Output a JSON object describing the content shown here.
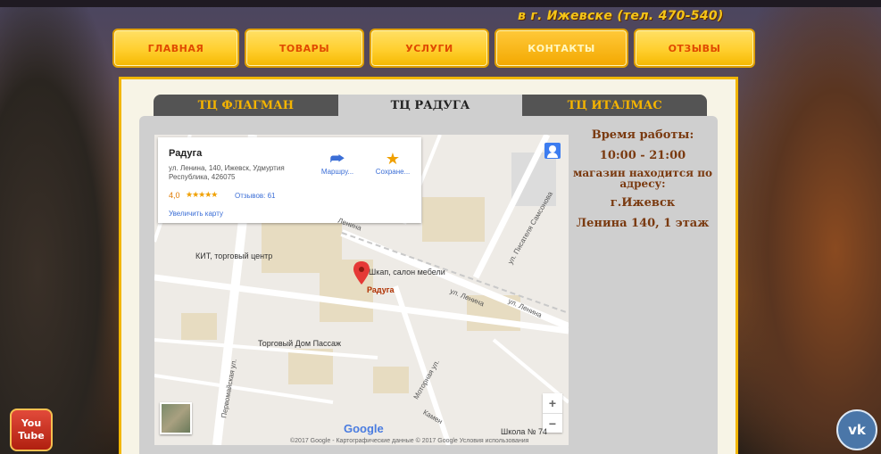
{
  "header": {
    "phone_line": "в г. Ижевске (тел. 470-540)"
  },
  "nav": {
    "items": [
      {
        "label": "ГЛАВНАЯ"
      },
      {
        "label": "ТОВАРЫ"
      },
      {
        "label": "УСЛУГИ"
      },
      {
        "label": "КОНТАКТЫ",
        "active": true
      },
      {
        "label": "ОТЗЫВЫ"
      }
    ]
  },
  "tabs": [
    {
      "label": "ТЦ ФЛАГМАН"
    },
    {
      "label": "ТЦ РАДУГА",
      "active": true
    },
    {
      "label": "ТЦ ИТАЛМАС"
    }
  ],
  "map": {
    "place_name": "Радуга",
    "address": "ул. Ленина, 140, Ижевск, Удмуртия Республика, 426075",
    "rating": "4,0",
    "stars": "★★★★★",
    "reviews": "Отзывов: 61",
    "enlarge": "Увеличить карту",
    "route_label": "Маршру...",
    "save_label": "Сохране...",
    "labels": {
      "kit": "КИТ, торговый центр",
      "shkap": "Шкап, салон мебели",
      "raduga": "Радуга",
      "passage": "Торговый Дом Пассаж",
      "school": "Школа № 74"
    },
    "roads": {
      "lenina1": "ул. Ленина",
      "lenina2": "ул. Ленина",
      "lenina3": "Ленина",
      "pisatelya": "ул. Писателя Самсонова",
      "pervomayskaya": "Первомайская ул.",
      "motornaya": "Моторная ул.",
      "kamenka": "Камен"
    },
    "google": "Google",
    "copyright": "©2017 Google - Картографические данные © 2017 Google   Условия использования",
    "zoom_in": "+",
    "zoom_out": "−"
  },
  "info": {
    "hours_title": "Время работы:",
    "hours": "10:00 - 21:00",
    "location_title": "магазин находится по адресу:",
    "city": "г.Ижевск",
    "street": "Ленина 140, 1 этаж"
  },
  "social": {
    "youtube_top": "You",
    "youtube_bottom": "Tube",
    "vk": "vk"
  }
}
